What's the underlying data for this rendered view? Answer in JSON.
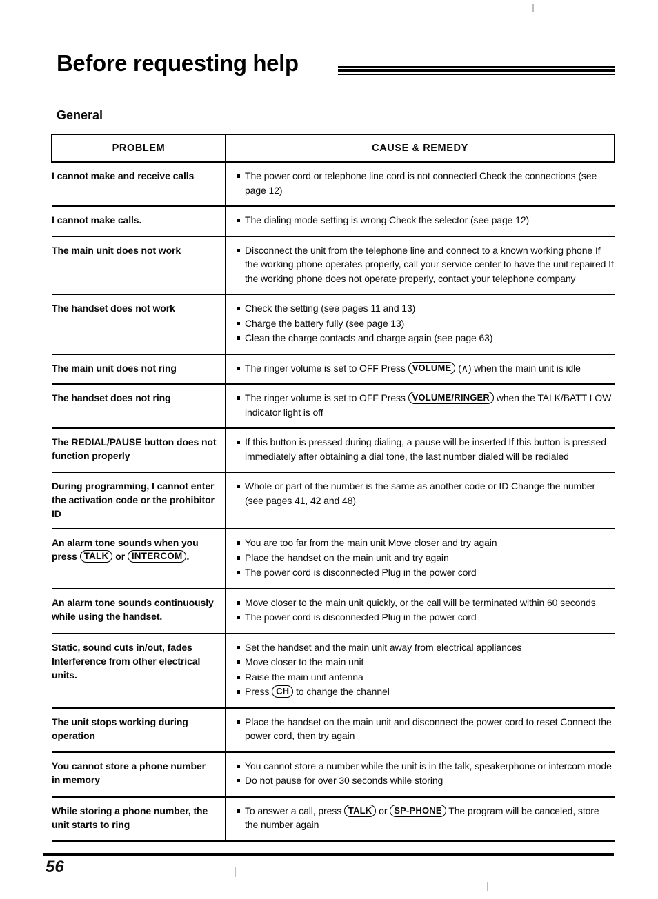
{
  "document": {
    "title": "Before requesting help",
    "section_heading": "General",
    "page_number": "56"
  },
  "table": {
    "headers": {
      "problem": "PROBLEM",
      "cause_remedy": "CAUSE & REMEDY"
    },
    "rows": [
      {
        "problem": "I cannot make and receive calls",
        "items": [
          "The power cord or telephone line cord is not connected  Check the connections (see page 12)"
        ]
      },
      {
        "problem": "I cannot make calls.",
        "items": [
          "The dialing mode setting is wrong  Check the selector (see page 12)"
        ]
      },
      {
        "problem": "The main unit does not work",
        "items": [
          "Disconnect the unit from the telephone line and connect to a known working phone  If the working phone operates properly, call your service center to have the unit repaired  If the working phone does not operate properly, contact your telephone company"
        ]
      },
      {
        "problem": "The handset does not work",
        "items": [
          "Check the setting (see pages 11 and 13)",
          "Charge the battery fully (see page 13)",
          "Clean the charge contacts and charge again (see page 63)"
        ]
      },
      {
        "problem": "The main unit does not ring",
        "items_rich": [
          [
            {
              "t": "text",
              "v": "The ringer volume is set to OFF  Press "
            },
            {
              "t": "key",
              "v": "VOLUME"
            },
            {
              "t": "text",
              "v": " (∧) when the main unit is idle"
            }
          ]
        ]
      },
      {
        "problem": "The handset does not ring",
        "items_rich": [
          [
            {
              "t": "text",
              "v": "The ringer volume is set to OFF  Press "
            },
            {
              "t": "key",
              "v": "VOLUME/RINGER"
            },
            {
              "t": "text",
              "v": " when the TALK/BATT LOW indicator light is off"
            }
          ]
        ]
      },
      {
        "problem": "The REDIAL/PAUSE button does not function properly",
        "items": [
          "If this button is pressed during dialing, a pause will be inserted  If this button is pressed immediately after obtaining a dial tone, the last number dialed will be redialed"
        ]
      },
      {
        "problem": "During programming, I cannot enter the activation code or the prohibitor ID",
        "items": [
          "Whole or part of the number is the same as another code or ID  Change the number (see pages 41, 42 and 48)"
        ]
      },
      {
        "problem_rich": [
          {
            "t": "text",
            "v": "An alarm tone sounds when you press "
          },
          {
            "t": "key",
            "v": "TALK"
          },
          {
            "t": "text",
            "v": " or "
          },
          {
            "t": "key",
            "v": "INTERCOM"
          },
          {
            "t": "text",
            "v": "."
          }
        ],
        "items": [
          "You are too far from the main unit  Move closer and try again",
          "Place the handset on the main unit and try again",
          "The power cord is disconnected  Plug in the power cord"
        ]
      },
      {
        "problem": "An alarm tone sounds continuously while using the handset.",
        "items": [
          "Move closer to the main unit quickly, or the call will be terminated within 60 seconds",
          "The power cord is disconnected  Plug in the power cord"
        ]
      },
      {
        "problem": "Static, sound cuts in/out, fades  Interference from other electrical units.",
        "items_rich": [
          [
            {
              "t": "text",
              "v": "Set the handset and the main unit away from electrical appliances"
            }
          ],
          [
            {
              "t": "text",
              "v": "Move closer to the main unit"
            }
          ],
          [
            {
              "t": "text",
              "v": "Raise the main unit antenna"
            }
          ],
          [
            {
              "t": "text",
              "v": "Press "
            },
            {
              "t": "key",
              "v": "CH"
            },
            {
              "t": "text",
              "v": " to change the channel"
            }
          ]
        ]
      },
      {
        "problem": "The unit stops working during operation",
        "items": [
          "Place the handset on the main unit and disconnect the power cord to reset  Connect the power cord, then try again"
        ]
      },
      {
        "problem": "You cannot store a phone number in memory",
        "items": [
          "You cannot store a number while the unit is in the talk, speakerphone or intercom mode",
          "Do not pause for over 30 seconds while storing"
        ]
      },
      {
        "problem": "While storing a phone number, the unit starts to ring",
        "items_rich": [
          [
            {
              "t": "text",
              "v": "To answer a call, press "
            },
            {
              "t": "key",
              "v": "TALK"
            },
            {
              "t": "text",
              "v": " or "
            },
            {
              "t": "key",
              "v": "SP-PHONE"
            },
            {
              "t": "text",
              "v": "  The program will be canceled, store the number again"
            }
          ]
        ]
      }
    ]
  }
}
